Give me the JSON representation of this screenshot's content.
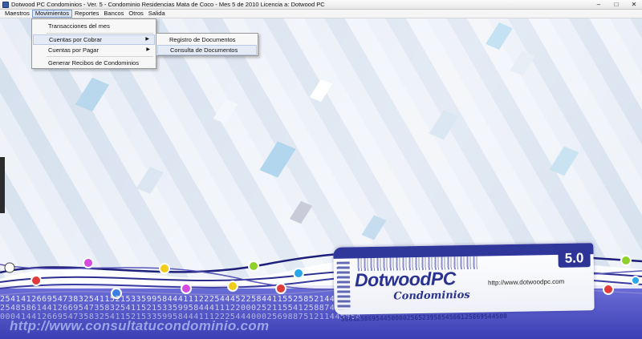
{
  "window": {
    "title": "Dotwood PC Condominios - Ver. 5   -  Condominio Residencias Mata de Coco   -  Mes 5 de 2010     Licencia a: Dotwood PC",
    "minimize": "–",
    "maximize": "□",
    "close": "✕"
  },
  "menubar": {
    "items": [
      "Maestros",
      "Movimientos",
      "Reportes",
      "Bancos",
      "Otros",
      "Salida"
    ]
  },
  "movimientos_menu": {
    "items": [
      {
        "label": "Transacciones del mes"
      },
      {
        "label": "Cuentas por Cobrar",
        "arrow": "▶"
      },
      {
        "label": "Cuentas por Pagar",
        "arrow": "▶"
      },
      {
        "label": "Generar Recibos de Condominios"
      }
    ]
  },
  "cuentas_cobrar_submenu": {
    "items": [
      {
        "label": "Registro de Documentos"
      },
      {
        "label": "Consulta de Documentos"
      }
    ]
  },
  "banner": {
    "digits_line1": "254141266954738325411521533599584441112225444522584411552585214416525441",
    "digits_line2": "254858614412669547358325411521533599584441112200025211554125887456325125",
    "digits_line3": "000414412669547358325411521533599584441112225444000256988751211445854",
    "url": "http://www.consultatucondominio.com"
  },
  "logo": {
    "brand": "DotwoodPC",
    "sub": "Condominios",
    "version": "5.0",
    "url": "http://www.dotwoodpc.com",
    "digits": "5661258695445000025652395854566125869544500"
  },
  "colors": {
    "brand_blue": "#2a3291",
    "menu_highlight": "#e4ebf6"
  }
}
